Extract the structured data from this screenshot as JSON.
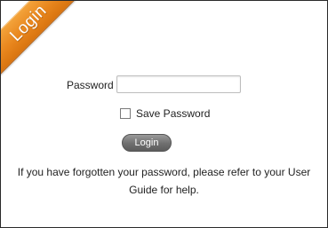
{
  "ribbon": {
    "label": "Login",
    "color": "#e8861d"
  },
  "form": {
    "password_label": "Password",
    "password_value": "",
    "save_password_label": "Save Password",
    "save_password_checked": false,
    "login_button_label": "Login"
  },
  "help": {
    "text": "If you have forgotten your password, please refer to your User Guide for help."
  }
}
